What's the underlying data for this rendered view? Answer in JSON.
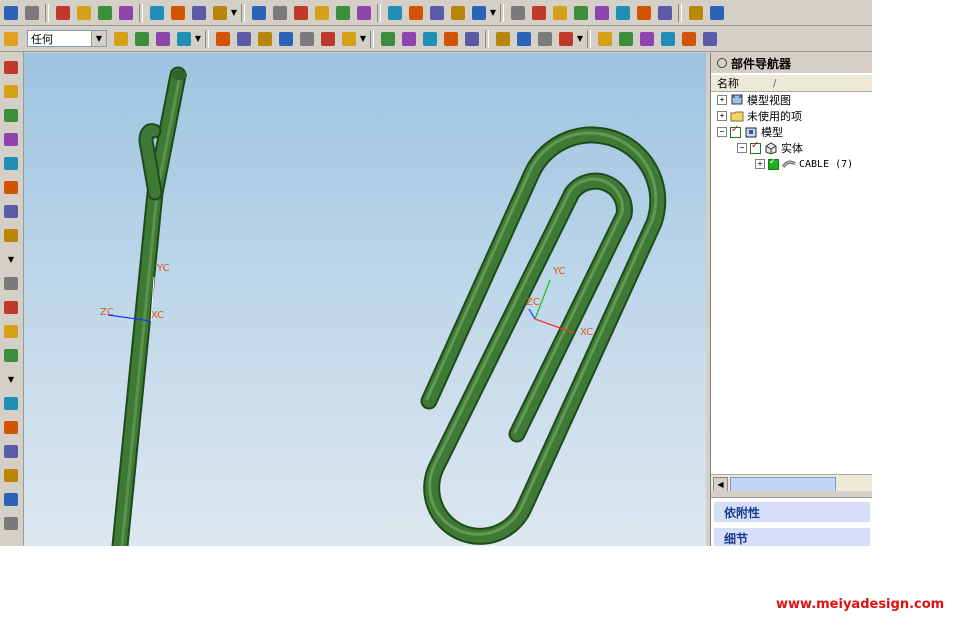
{
  "toolbar_row1": {
    "icons": [
      "save-icon",
      "print-icon",
      "cut-icon",
      "copy-icon",
      "paste-icon",
      "delete-icon",
      "undo-icon",
      "edit-icon",
      "transform-icon",
      "info-icon",
      "fit-icon",
      "zoom-area-icon",
      "pan-icon",
      "zoom-icon",
      "rotate-icon",
      "view-icon",
      "snap-view-icon",
      "shaded-view-icon",
      "wireframe-icon",
      "layer-icon",
      "face-analysis-icon",
      "curve-analysis-icon",
      "section-icon",
      "measure-icon",
      "color-icon",
      "analysis-icon",
      "render-icon",
      "explode-icon",
      "light-icon",
      "flag-icon",
      "package-icon"
    ]
  },
  "toolbar_row2": {
    "filter_value": "任何",
    "icons": [
      "snap-point-icon",
      "feature-icon",
      "sweep-icon",
      "block-icon",
      "line-icon",
      "arc-icon",
      "spline-icon",
      "intersection-icon",
      "circle-icon",
      "point-icon",
      "plane-icon",
      "datum-icon",
      "offset-icon",
      "surface-icon",
      "curve-icon",
      "trim-icon",
      "extend-icon",
      "join-icon",
      "extract-icon",
      "project-icon",
      "bridge-icon",
      "fillet-icon",
      "chamfer-icon",
      "corner-icon",
      "section-curve-icon",
      "helix-icon"
    ]
  },
  "left_toolbar": {
    "icons": [
      "sketch-icon",
      "extrude-icon",
      "revolve-icon",
      "boolean-icon",
      "thicken-icon",
      "color-fill-icon",
      "edge-blend-icon",
      "tube-icon",
      "more-icon",
      "hole-icon",
      "pattern-icon",
      "move-face-icon",
      "sync-icon",
      "more-icon-2",
      "arrow-icon",
      "assembly-icon",
      "component-icon",
      "mate-icon",
      "drafting-icon",
      "sheet-icon"
    ]
  },
  "viewport": {
    "left_axes": {
      "yc": "YC",
      "zc": "ZC",
      "xc": "XC"
    },
    "right_axes": {
      "yc": "YC",
      "zc": "ZC",
      "xc": "XC"
    },
    "model_color": "#3e7a35"
  },
  "navigator": {
    "title": "部件导航器",
    "column_name": "名称",
    "column_sort": "/",
    "tree": [
      {
        "label": "模型视图",
        "expander": "+"
      },
      {
        "label": "未使用的项",
        "expander": "+"
      },
      {
        "label": "模型",
        "expander": "−"
      },
      {
        "label": "实体",
        "expander": "−"
      },
      {
        "label": "CABLE (7)",
        "expander": "+"
      }
    ],
    "panels": {
      "dependencies": "依附性",
      "details": "细节"
    }
  },
  "watermark": "www.meiyadesign.com"
}
